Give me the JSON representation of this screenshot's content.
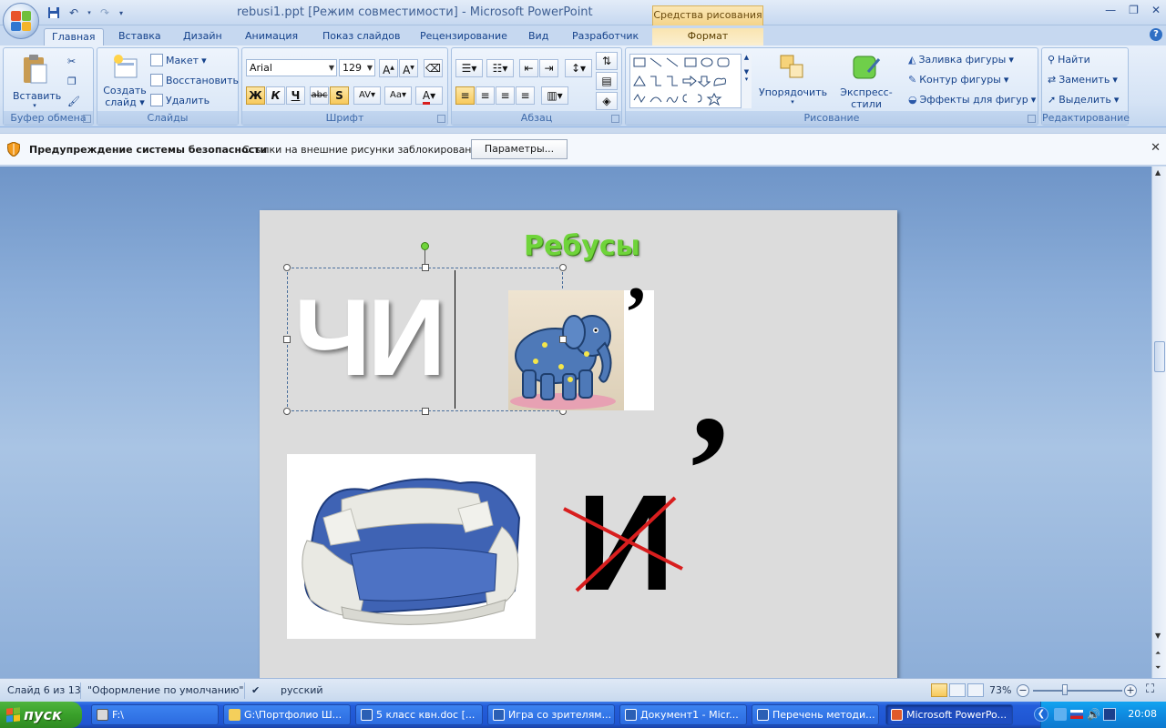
{
  "window": {
    "title": "rebusi1.ppt [Режим совместимости] - Microsoft PowerPoint",
    "context_tab_group": "Средства рисования"
  },
  "tabs": [
    "Главная",
    "Вставка",
    "Дизайн",
    "Анимация",
    "Показ слайдов",
    "Рецензирование",
    "Вид",
    "Разработчик",
    "Формат"
  ],
  "ribbon": {
    "clipboard": {
      "label": "Буфер обмена",
      "paste": "Вставить"
    },
    "slides": {
      "label": "Слайды",
      "new_slide": "Создать",
      "new_slide_2": "слайд",
      "layout": "Макет",
      "reset": "Восстановить",
      "delete": "Удалить"
    },
    "font": {
      "label": "Шрифт",
      "font_name": "Arial",
      "font_size": "129"
    },
    "paragraph": {
      "label": "Абзац"
    },
    "drawing": {
      "label": "Рисование",
      "arrange": "Упорядочить",
      "quick_styles": "Экспресс-стили",
      "fill": "Заливка фигуры",
      "outline": "Контур фигуры",
      "effects": "Эффекты для фигур"
    },
    "editing": {
      "label": "Редактирование",
      "find": "Найти",
      "replace": "Заменить",
      "select": "Выделить"
    }
  },
  "security_bar": {
    "title": "Предупреждение системы безопасности",
    "message": "Ссылки на внешние рисунки заблокированы",
    "button": "Параметры..."
  },
  "slide": {
    "title": "Ребусы",
    "text_chi": "ЧИ",
    "letter_i": "И",
    "comma": "’",
    "comma_big": "’"
  },
  "status": {
    "slide_info": "Слайд 6 из 13",
    "theme": "\"Оформление по умолчанию\"",
    "language": "русский",
    "zoom": "73%"
  },
  "taskbar": {
    "start": "пуск",
    "tasks": [
      "F:\\",
      "G:\\Портфолио Ш...",
      "5 класс квн.doc [...",
      "Игра со зрителям...",
      "Документ1 - Micr...",
      "Перечень методи...",
      "Microsoft PowerPo..."
    ],
    "clock": "20:08"
  },
  "colors": {
    "title_green": "#6fd43a",
    "strike_red": "#d81e1e",
    "taskbar_blue": "#245edb",
    "start_green": "#39a02a"
  }
}
